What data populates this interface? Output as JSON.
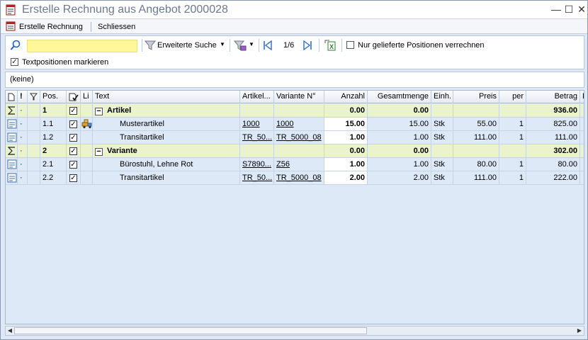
{
  "window": {
    "title": "Erstelle Rechnung aus Angebot 2000028",
    "minimize": "—",
    "maximize": "☐",
    "close": "✕"
  },
  "menu": {
    "create_invoice": "Erstelle Rechnung",
    "close": "Schliessen"
  },
  "toolbar": {
    "search_value": "",
    "advanced_search": "Erweiterte Suche",
    "page_indicator": "1/6",
    "only_delivered_label": "Nur gelieferte Positionen verrechnen",
    "only_delivered_checked": false,
    "mark_text_positions_label": "Textpositionen markieren",
    "mark_text_positions_checked": true
  },
  "filter": {
    "value": "(keine)"
  },
  "grid": {
    "headers": {
      "flag": "!",
      "pos": "Pos.",
      "li": "Li",
      "text": "Text",
      "article": "Artikel...",
      "variant": "Variante N°",
      "qty": "Anzahl",
      "total_qty": "Gesamtmenge",
      "unit": "Einh.",
      "price": "Preis",
      "per": "per",
      "amount": "Betrag",
      "extra": "L"
    },
    "rows": [
      {
        "type": "group",
        "dot": "·",
        "pos": "1",
        "text": "Artikel",
        "article": "",
        "variant": "",
        "qty": "0.00",
        "total_qty": "0.00",
        "unit": "",
        "price": "",
        "per": "",
        "amount": "936.00"
      },
      {
        "type": "item",
        "dot": "·",
        "pos": "1.1",
        "text": "Musterartikel",
        "article": "1000",
        "variant": "1000",
        "qty": "15.00",
        "total_qty": "15.00",
        "unit": "Stk",
        "price": "55.00",
        "per": "1",
        "amount": "825.00"
      },
      {
        "type": "item",
        "dot": "·",
        "pos": "1.2",
        "text": "Transitartikel",
        "article": "TR_50...",
        "variant": "TR_5000_08",
        "qty": "1.00",
        "total_qty": "1.00",
        "unit": "Stk",
        "price": "111.00",
        "per": "1",
        "amount": "111.00"
      },
      {
        "type": "group",
        "dot": "·",
        "pos": "2",
        "text": "Variante",
        "article": "",
        "variant": "",
        "qty": "0.00",
        "total_qty": "0.00",
        "unit": "",
        "price": "",
        "per": "",
        "amount": "302.00"
      },
      {
        "type": "item",
        "dot": "·",
        "pos": "2.1",
        "text": "Bürostuhl, Lehne Rot",
        "article": "S7890...",
        "variant": "Z56",
        "qty": "1.00",
        "total_qty": "1.00",
        "unit": "Stk",
        "price": "80.00",
        "per": "1",
        "amount": "80.00"
      },
      {
        "type": "item",
        "dot": "·",
        "pos": "2.2",
        "text": "Transitartikel",
        "article": "TR_50...",
        "variant": "TR_5000_08",
        "qty": "2.00",
        "total_qty": "2.00",
        "unit": "Stk",
        "price": "111.00",
        "per": "1",
        "amount": "222.00"
      }
    ]
  }
}
